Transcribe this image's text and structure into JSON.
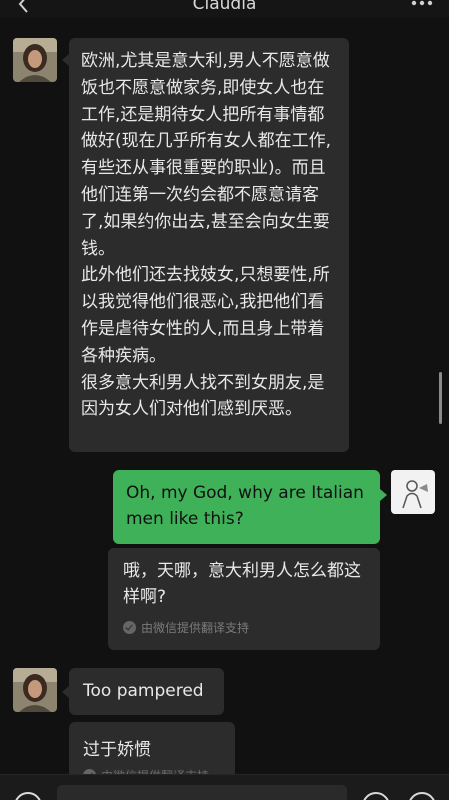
{
  "header": {
    "title": "Claudia",
    "back_icon": "chevron-left-icon",
    "more_icon": "more-dots-icon"
  },
  "messages": [
    {
      "side": "left",
      "text": "欧洲,尤其是意大利,男人不愿意做饭也不愿意做家务,即使女人也在工作,还是期待女人把所有事情都做好(现在几乎所有女人都在工作,有些还从事很重要的职业)。而且他们连第一次约会都不愿意请客了,如果约你出去,甚至会向女生要钱。\n此外他们还去找妓女,只想要性,所以我觉得他们很恶心,我把他们看作是虐待女性的人,而且身上带着各种疾病。\n很多意大利男人找不到女朋友,是因为女人们对他们感到厌恶。"
    },
    {
      "side": "right",
      "text": "Oh, my God, why are Italian men like this?",
      "translation": "哦，天哪，意大利男人怎么都这样啊?",
      "translation_note": "由微信提供翻译支持"
    },
    {
      "side": "left",
      "text": "Too pampered",
      "translation": "过于娇惯",
      "translation_note": "由微信提供翻译支持"
    }
  ],
  "colors": {
    "background": "#111111",
    "bubble_dark": "#2c2c2c",
    "bubble_green": "#3fb158"
  }
}
